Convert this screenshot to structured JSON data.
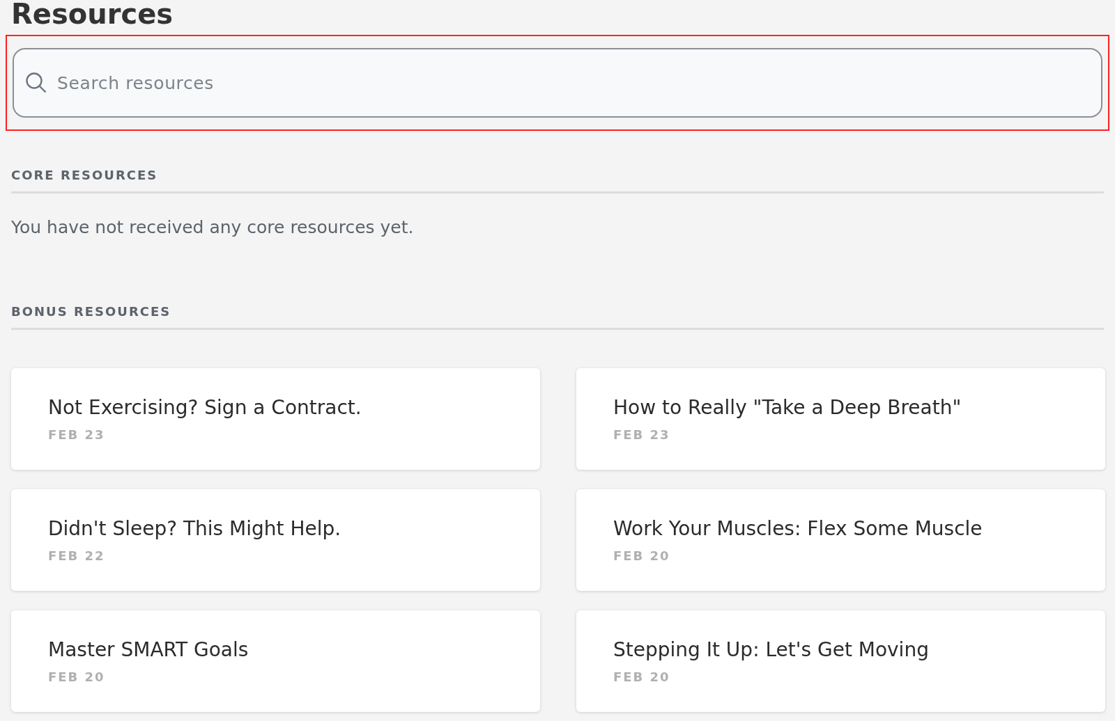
{
  "page": {
    "title": "Resources"
  },
  "search": {
    "placeholder": "Search resources",
    "highlighted": true
  },
  "core_section": {
    "heading": "CORE RESOURCES",
    "empty_text": "You have not received any core resources yet."
  },
  "bonus_section": {
    "heading": "BONUS RESOURCES",
    "resources": [
      {
        "title": "Not Exercising? Sign a Contract.",
        "date": "FEB 23"
      },
      {
        "title": "How to Really \"Take a Deep Breath\"",
        "date": "FEB 23"
      },
      {
        "title": "Didn't Sleep? This Might Help.",
        "date": "FEB 22"
      },
      {
        "title": "Work Your Muscles: Flex Some Muscle",
        "date": "FEB 20"
      },
      {
        "title": "Master SMART Goals",
        "date": "FEB 20"
      },
      {
        "title": "Stepping It Up: Let's Get Moving",
        "date": "FEB 20"
      }
    ]
  }
}
